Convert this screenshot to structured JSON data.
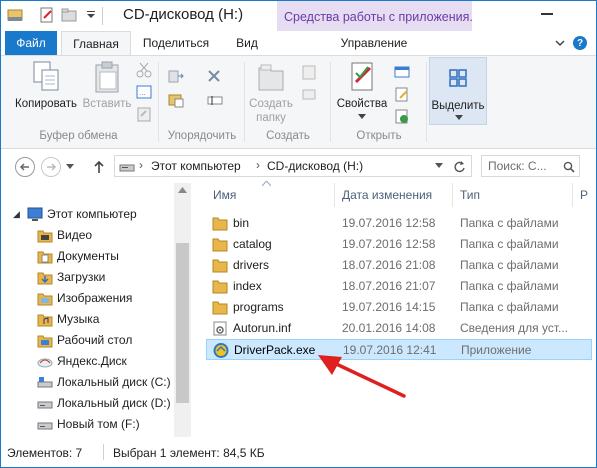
{
  "window": {
    "title": "CD-дисковод (H:)",
    "contextual_tab_group": "Средства работы с приложения..."
  },
  "tabs": {
    "file": "Файл",
    "home": "Главная",
    "share": "Поделиться",
    "view": "Вид",
    "manage": "Управление"
  },
  "ribbon": {
    "copy": "Копировать",
    "paste": "Вставить",
    "clipboard_group": "Буфер обмена",
    "organize_group": "Упорядочить",
    "new_folder_line1": "Создать",
    "new_folder_line2": "папку",
    "create_group": "Создать",
    "properties": "Свойства",
    "open_group": "Открыть",
    "select": "Выделить"
  },
  "address": {
    "segments": [
      "Этот компьютер",
      "CD-дисковод (H:)"
    ],
    "search_placeholder": "Поиск: С..."
  },
  "nav": {
    "items": [
      {
        "label": "Этот компьютер",
        "icon": "computer-icon"
      },
      {
        "label": "Видео",
        "icon": "video-folder-icon"
      },
      {
        "label": "Документы",
        "icon": "documents-folder-icon"
      },
      {
        "label": "Загрузки",
        "icon": "downloads-folder-icon"
      },
      {
        "label": "Изображения",
        "icon": "pictures-folder-icon"
      },
      {
        "label": "Музыка",
        "icon": "music-folder-icon"
      },
      {
        "label": "Рабочий стол",
        "icon": "desktop-folder-icon"
      },
      {
        "label": "Яндекс.Диск",
        "icon": "cloud-disk-icon"
      },
      {
        "label": "Локальный диск (C:)",
        "icon": "system-drive-icon"
      },
      {
        "label": "Локальный диск (D:)",
        "icon": "drive-icon"
      },
      {
        "label": "Новый том (F:)",
        "icon": "drive-icon"
      }
    ]
  },
  "columns": {
    "name": "Имя",
    "date": "Дата изменения",
    "type": "Тип",
    "size": "Р"
  },
  "files": [
    {
      "name": "bin",
      "date": "19.07.2016 12:58",
      "type": "Папка с файлами",
      "icon": "folder-icon"
    },
    {
      "name": "catalog",
      "date": "19.07.2016 12:58",
      "type": "Папка с файлами",
      "icon": "folder-icon"
    },
    {
      "name": "drivers",
      "date": "18.07.2016 21:08",
      "type": "Папка с файлами",
      "icon": "folder-icon"
    },
    {
      "name": "index",
      "date": "18.07.2016 21:07",
      "type": "Папка с файлами",
      "icon": "folder-icon"
    },
    {
      "name": "programs",
      "date": "19.07.2016 14:15",
      "type": "Папка с файлами",
      "icon": "folder-icon"
    },
    {
      "name": "Autorun.inf",
      "date": "20.01.2016 14:08",
      "type": "Сведения для уст...",
      "icon": "settings-file-icon"
    },
    {
      "name": "DriverPack.exe",
      "date": "19.07.2016 12:41",
      "type": "Приложение",
      "icon": "driverpack-app-icon"
    }
  ],
  "status": {
    "count": "Элементов: 7",
    "selected": "Выбран 1 элемент: 84,5 КБ"
  },
  "colors": {
    "accent": "#1979ca",
    "selection": "#cce8ff",
    "arrow": "#e02020",
    "folder": "#e8b64a"
  }
}
